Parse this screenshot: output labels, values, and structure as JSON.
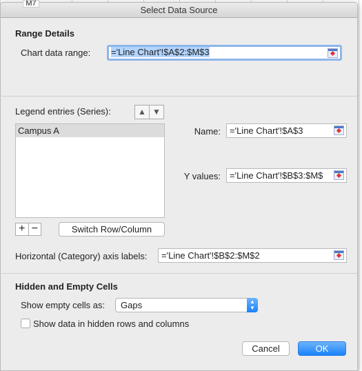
{
  "tooltip": "M7",
  "title": "Select Data Source",
  "range": {
    "heading": "Range Details",
    "label": "Chart data range:",
    "value": "='Line Chart'!$A$2:$M$3"
  },
  "legend": {
    "label": "Legend entries (Series):",
    "items": [
      "Campus A"
    ],
    "up_icon": "arrow-up",
    "down_icon": "arrow-down"
  },
  "series": {
    "name_label": "Name:",
    "name_value": "='Line Chart'!$A$3",
    "y_label": "Y values:",
    "y_value": "='Line Chart'!$B$3:$M$"
  },
  "buttons": {
    "add": "+",
    "remove": "−",
    "switch": "Switch Row/Column",
    "cancel": "Cancel",
    "ok": "OK"
  },
  "axis": {
    "label": "Horizontal (Category) axis labels:",
    "value": "='Line Chart'!$B$2:$M$2"
  },
  "hidden": {
    "heading": "Hidden and Empty Cells",
    "empty_label": "Show empty cells as:",
    "empty_value": "Gaps",
    "checkbox_label": "Show data in hidden rows and columns",
    "checkbox_checked": false
  },
  "colors": {
    "accent": "#1a82fb",
    "selection": "#b3d4fd"
  }
}
